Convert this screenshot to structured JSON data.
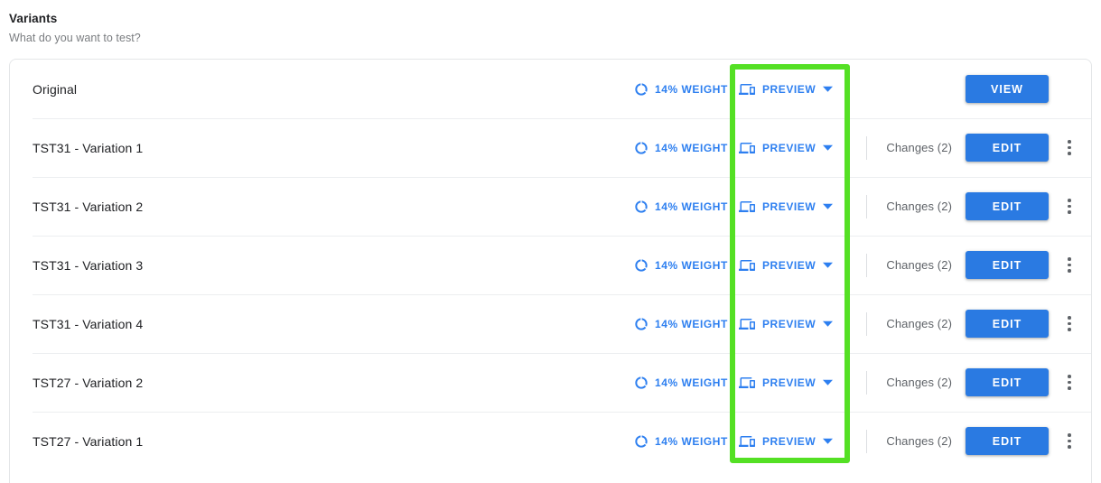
{
  "header": {
    "title": "Variants",
    "subtitle": "What do you want to test?"
  },
  "labels": {
    "weight_text": "14% WEIGHT",
    "preview_text": "PREVIEW",
    "changes_text": "Changes (2)",
    "view_button": "VIEW",
    "edit_button": "EDIT"
  },
  "icons": {
    "weight": "data-usage-donut-icon",
    "preview": "devices-icon",
    "caret": "chevron-down-icon",
    "kebab": "more-vert-icon"
  },
  "colors": {
    "accent_blue": "#2a7ae2",
    "link_blue": "#2d7ff0",
    "annotation_green": "#54e024",
    "divider": "#eceef0",
    "text_primary": "#202124",
    "text_secondary": "#5f6368"
  },
  "rows": [
    {
      "name": "Original",
      "weight": "14% WEIGHT",
      "preview": "PREVIEW",
      "changes": "",
      "action": "VIEW",
      "has_changes": false,
      "has_kebab": false
    },
    {
      "name": "TST31 - Variation 1",
      "weight": "14% WEIGHT",
      "preview": "PREVIEW",
      "changes": "Changes (2)",
      "action": "EDIT",
      "has_changes": true,
      "has_kebab": true
    },
    {
      "name": "TST31 - Variation 2",
      "weight": "14% WEIGHT",
      "preview": "PREVIEW",
      "changes": "Changes (2)",
      "action": "EDIT",
      "has_changes": true,
      "has_kebab": true
    },
    {
      "name": "TST31 - Variation 3",
      "weight": "14% WEIGHT",
      "preview": "PREVIEW",
      "changes": "Changes (2)",
      "action": "EDIT",
      "has_changes": true,
      "has_kebab": true
    },
    {
      "name": "TST31 - Variation 4",
      "weight": "14% WEIGHT",
      "preview": "PREVIEW",
      "changes": "Changes (2)",
      "action": "EDIT",
      "has_changes": true,
      "has_kebab": true
    },
    {
      "name": "TST27 - Variation 2",
      "weight": "14% WEIGHT",
      "preview": "PREVIEW",
      "changes": "Changes (2)",
      "action": "EDIT",
      "has_changes": true,
      "has_kebab": true
    },
    {
      "name": "TST27 - Variation 1",
      "weight": "14% WEIGHT",
      "preview": "PREVIEW",
      "changes": "Changes (2)",
      "action": "EDIT",
      "has_changes": true,
      "has_kebab": true
    }
  ]
}
